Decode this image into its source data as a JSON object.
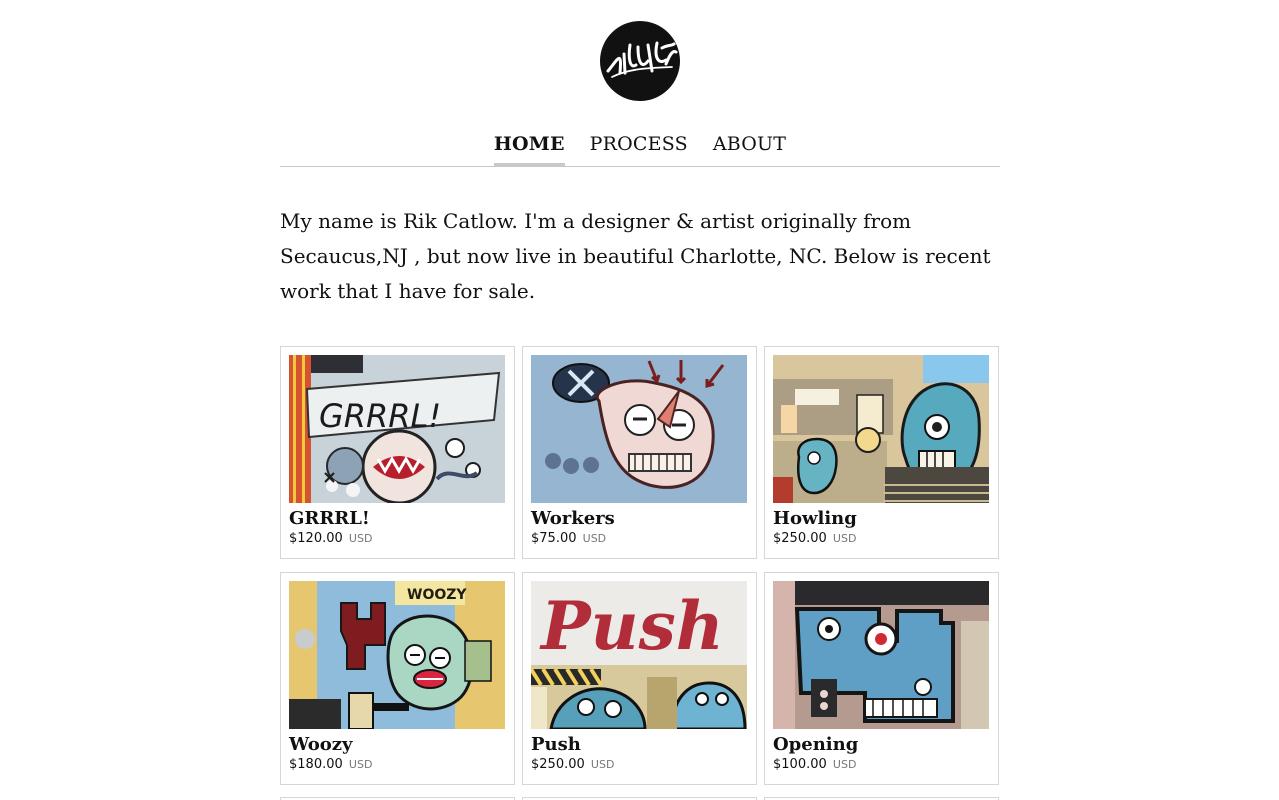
{
  "brand": {
    "logo_signature": "rikcat"
  },
  "nav": {
    "items": [
      {
        "label": "HOME",
        "active": true
      },
      {
        "label": "PROCESS",
        "active": false
      },
      {
        "label": "ABOUT",
        "active": false
      }
    ]
  },
  "intro": {
    "text": "My name is Rik Catlow. I'm a designer & artist originally from Secaucus,NJ , but now live in beautiful Charlotte, NC. Below is recent work that I have for sale."
  },
  "products": [
    {
      "title": "GRRRL!",
      "price": "$120.00",
      "currency": "USD"
    },
    {
      "title": "Workers",
      "price": "$75.00",
      "currency": "USD"
    },
    {
      "title": "Howling",
      "price": "$250.00",
      "currency": "USD"
    },
    {
      "title": "Woozy",
      "price": "$180.00",
      "currency": "USD"
    },
    {
      "title": "Push",
      "price": "$250.00",
      "currency": "USD"
    },
    {
      "title": "Opening",
      "price": "$100.00",
      "currency": "USD"
    }
  ],
  "artwork_text": {
    "grrrl": "GRRRL!",
    "push": "Push",
    "woozy": "WOOZY"
  },
  "colors": {
    "text": "#111111",
    "muted": "#777777",
    "border": "#d6d6d6",
    "nav_active_underline": "#c9c9c9"
  }
}
